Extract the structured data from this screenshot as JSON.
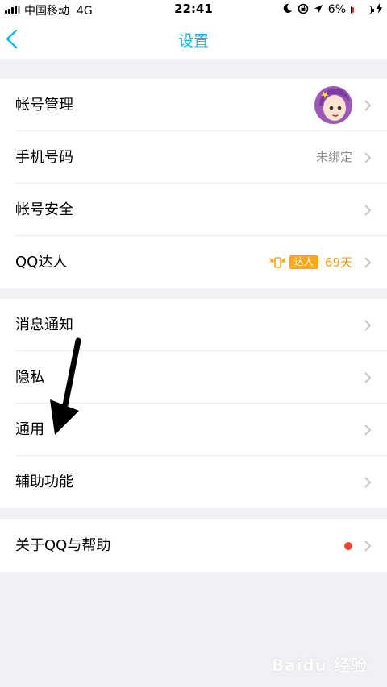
{
  "status_bar": {
    "carrier": "中国移动",
    "network": "4G",
    "time": "22:41",
    "battery_percent_text": "6%",
    "battery_level": 0.06
  },
  "nav": {
    "title": "设置"
  },
  "groups": [
    {
      "rows": [
        {
          "label": "帐号管理"
        },
        {
          "label": "手机号码",
          "detail": "未绑定"
        },
        {
          "label": "帐号安全"
        },
        {
          "label": "QQ达人",
          "badge": "达人",
          "days": "69天"
        }
      ]
    },
    {
      "rows": [
        {
          "label": "消息通知"
        },
        {
          "label": "隐私"
        },
        {
          "label": "通用"
        },
        {
          "label": "辅助功能"
        }
      ]
    },
    {
      "rows": [
        {
          "label": "关于QQ与帮助"
        }
      ]
    }
  ],
  "colors": {
    "accent": "#12b7f5",
    "background": "#f1f1f5",
    "badge": "#f9a71d",
    "red_dot": "#f0442f"
  },
  "watermark": "Baidu 经验"
}
